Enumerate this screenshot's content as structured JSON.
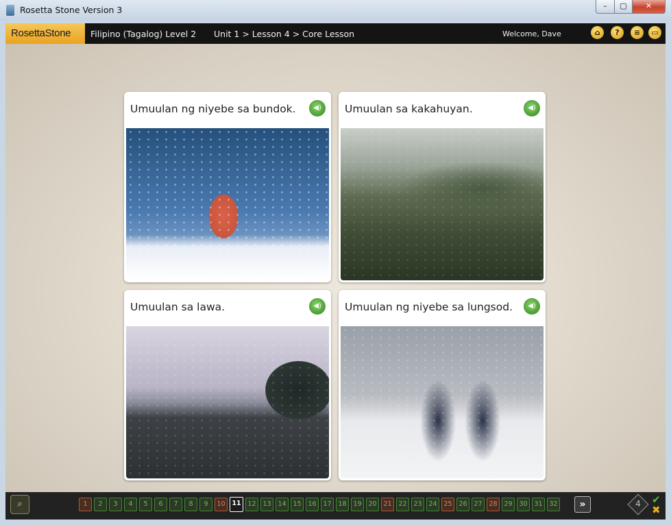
{
  "window": {
    "title": "Rosetta Stone Version 3",
    "controls": {
      "minimize": "–",
      "maximize": "▢",
      "close": "✕"
    }
  },
  "header": {
    "logo": "RosettaStone",
    "course": "Filipino (Tagalog) Level 2",
    "breadcrumb": "Unit 1 > Lesson 4 > Core Lesson",
    "welcome": "Welcome, Dave",
    "icons": [
      "home-icon",
      "help-icon",
      "menu-icon",
      "window-icon"
    ]
  },
  "cards": [
    {
      "caption": "Umuulan ng niyebe sa bundok.",
      "image": "woman in snow on mountain"
    },
    {
      "caption": "Umuulan sa kakahuyan.",
      "image": "rain over forest"
    },
    {
      "caption": "Umuulan sa lawa.",
      "image": "rain over lake"
    },
    {
      "caption": "Umuulan ng niyebe sa lungsod.",
      "image": "people walking in snowy city"
    }
  ],
  "progress": {
    "pages": [
      {
        "n": "1",
        "state": "missed"
      },
      {
        "n": "2",
        "state": "done"
      },
      {
        "n": "3",
        "state": "done"
      },
      {
        "n": "4",
        "state": "done"
      },
      {
        "n": "5",
        "state": "done"
      },
      {
        "n": "6",
        "state": "done"
      },
      {
        "n": "7",
        "state": "done"
      },
      {
        "n": "8",
        "state": "done"
      },
      {
        "n": "9",
        "state": "done"
      },
      {
        "n": "10",
        "state": "missed"
      },
      {
        "n": "11",
        "state": "current"
      },
      {
        "n": "12",
        "state": "done"
      },
      {
        "n": "13",
        "state": "done"
      },
      {
        "n": "14",
        "state": "done"
      },
      {
        "n": "15",
        "state": "done"
      },
      {
        "n": "16",
        "state": "done"
      },
      {
        "n": "17",
        "state": "done"
      },
      {
        "n": "18",
        "state": "done"
      },
      {
        "n": "19",
        "state": "done"
      },
      {
        "n": "20",
        "state": "done"
      },
      {
        "n": "21",
        "state": "missed"
      },
      {
        "n": "22",
        "state": "done"
      },
      {
        "n": "23",
        "state": "done"
      },
      {
        "n": "24",
        "state": "done"
      },
      {
        "n": "25",
        "state": "missed"
      },
      {
        "n": "26",
        "state": "done"
      },
      {
        "n": "27",
        "state": "done"
      },
      {
        "n": "28",
        "state": "missed"
      },
      {
        "n": "29",
        "state": "done"
      },
      {
        "n": "30",
        "state": "done"
      },
      {
        "n": "31",
        "state": "done"
      },
      {
        "n": "32",
        "state": "done"
      }
    ],
    "next_label": "»",
    "score": "4"
  },
  "colors": {
    "accent": "#e9a321",
    "header_bg": "#141414",
    "done": "#3f8a2f",
    "missed": "#a95b3a"
  }
}
